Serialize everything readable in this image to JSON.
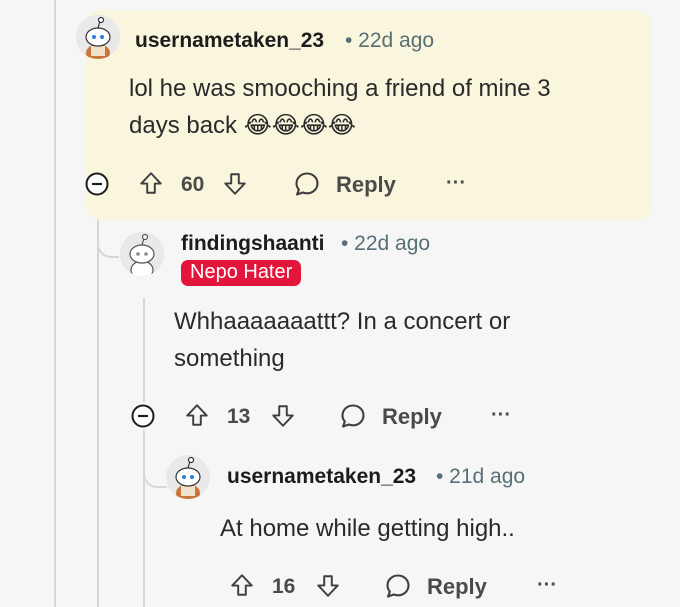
{
  "comments": [
    {
      "username": "usernametaken_23",
      "time": "• 22d ago",
      "body_line1": "lol he was smooching a friend of mine 3",
      "body_line2": "days back 😂😂😂😂",
      "votes": "60",
      "reply_label": "Reply",
      "more_label": "···"
    },
    {
      "username": "findingshaanti",
      "time": "• 22d ago",
      "flair": "Nepo Hater",
      "body_line1": "Whhaaaaaaattt? In a concert or",
      "body_line2": "something",
      "votes": "13",
      "reply_label": "Reply",
      "more_label": "···"
    },
    {
      "username": "usernametaken_23",
      "time": "• 21d ago",
      "body_line1": "At home while getting high..",
      "votes": "16",
      "reply_label": "Reply",
      "more_label": "···"
    }
  ],
  "colors": {
    "highlight": "#faf6dd",
    "flair_bg": "#e4153a",
    "text_muted": "#576f76",
    "thread_line": "#d6d6d6"
  },
  "icons": [
    "snoo-avatar-icon",
    "collapse-icon",
    "upvote-icon",
    "downvote-icon",
    "comment-bubble-icon",
    "more-options-icon"
  ]
}
